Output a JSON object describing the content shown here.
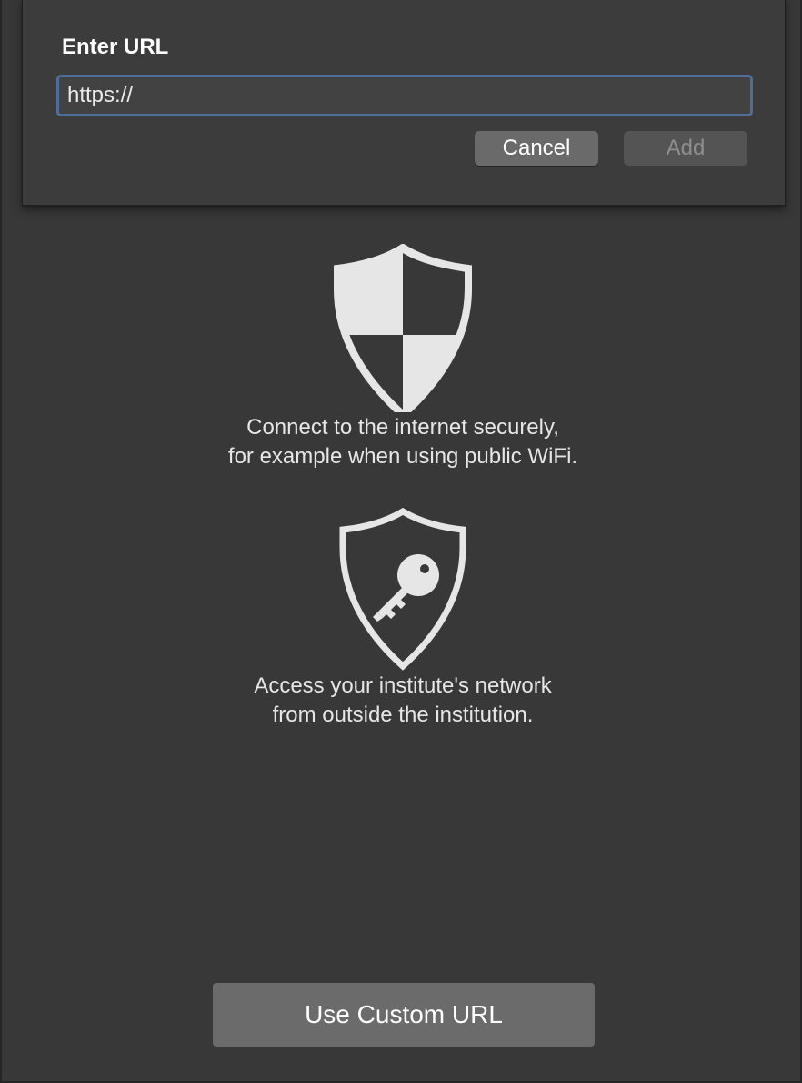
{
  "dialog": {
    "title": "Enter URL",
    "url_value": "https://",
    "cancel_label": "Cancel",
    "add_label": "Add"
  },
  "features": [
    {
      "icon": "shield-secure-icon",
      "line1": "Connect to the internet securely,",
      "line2": "for example when using public WiFi."
    },
    {
      "icon": "shield-key-icon",
      "line1": "Access your institute's network",
      "line2": "from outside the institution."
    }
  ],
  "footer": {
    "custom_url_label": "Use Custom URL"
  },
  "colors": {
    "window_bg": "#383838",
    "sheet_bg": "#3c3c3c",
    "focus_ring": "#4f6d97",
    "icon_fill": "#e6e6e6"
  }
}
